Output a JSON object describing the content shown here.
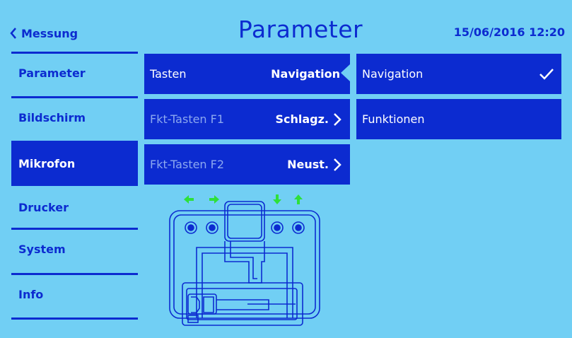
{
  "header": {
    "back_label": "Messung",
    "title": "Parameter",
    "datetime": "15/06/2016 12:20"
  },
  "sidebar": {
    "items": [
      {
        "label": "Parameter"
      },
      {
        "label": "Bildschirm"
      },
      {
        "label": "Mikrofon"
      },
      {
        "label": "Drucker"
      },
      {
        "label": "System"
      },
      {
        "label": "Info"
      }
    ],
    "active": "Mikrofon"
  },
  "settings": [
    {
      "label": "Tasten",
      "value": "Navigation"
    },
    {
      "label": "Fkt-Tasten F1",
      "value": "Schlagz."
    },
    {
      "label": "Fkt-Tasten F2",
      "value": "Neust."
    }
  ],
  "options": [
    {
      "label": "Navigation",
      "selected": true
    },
    {
      "label": "Funktionen",
      "selected": false
    }
  ],
  "colors": {
    "background": "#71cff4",
    "accent": "#0c2bd0",
    "arrow_green": "#2ee03a"
  },
  "icons": {
    "back": "chevron-left-icon",
    "next": "chevron-right-icon",
    "selected": "checkmark-icon"
  }
}
